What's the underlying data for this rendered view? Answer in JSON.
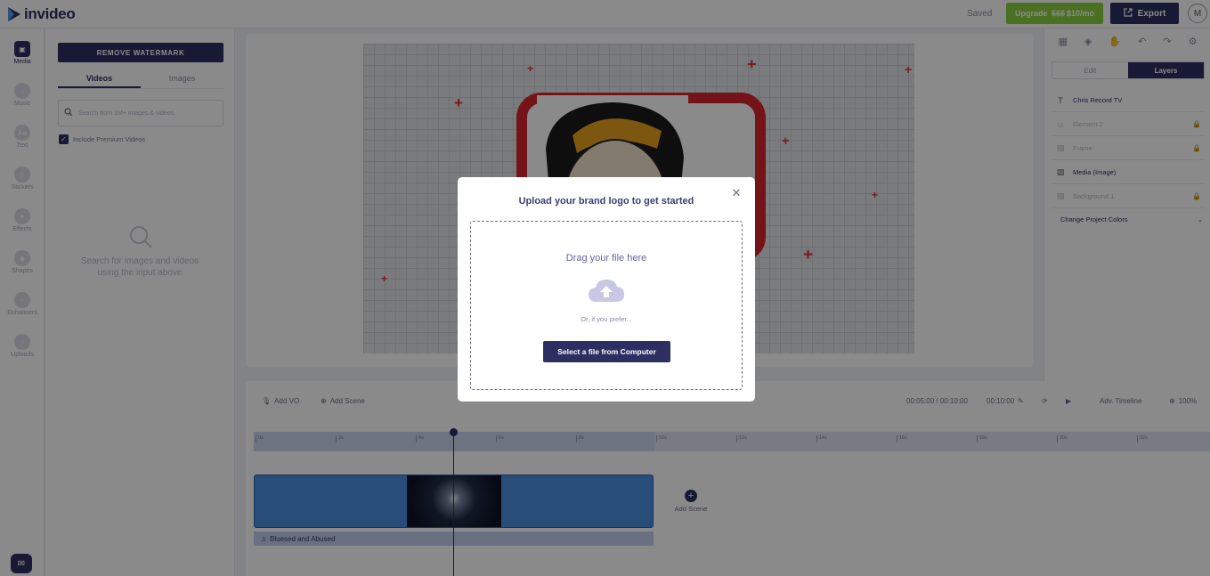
{
  "app": {
    "name": "invideo"
  },
  "header": {
    "saved_label": "Saved",
    "upgrade_label": "Upgrade",
    "upgrade_old_price": "$$$",
    "upgrade_price": "$10/mo",
    "export_label": "Export",
    "avatar_initial": "M"
  },
  "rail": {
    "items": [
      {
        "label": "Media",
        "icon": "media-icon"
      },
      {
        "label": "Music",
        "icon": "music-icon"
      },
      {
        "label": "Text",
        "icon": "text-icon"
      },
      {
        "label": "Stickers",
        "icon": "sticker-icon"
      },
      {
        "label": "Effects",
        "icon": "effects-icon"
      },
      {
        "label": "Shapes",
        "icon": "shapes-icon"
      },
      {
        "label": "Enhancers",
        "icon": "enhancers-icon"
      },
      {
        "label": "Uploads",
        "icon": "uploads-icon"
      }
    ]
  },
  "media": {
    "remove_watermark_label": "REMOVE WATERMARK",
    "tabs": [
      {
        "label": "Videos"
      },
      {
        "label": "Images"
      }
    ],
    "search_placeholder": "Search from 1M+ images & videos",
    "premium_label": "Include Premium Videos",
    "empty_text": "Search for images and videos using the input above"
  },
  "right_panel": {
    "tabs": [
      {
        "label": "Edit"
      },
      {
        "label": "Layers"
      }
    ],
    "layers": [
      {
        "name": "Chris Record TV",
        "icon": "text-layer-icon",
        "dim": false,
        "locked": false
      },
      {
        "name": "Element 2",
        "icon": "element-layer-icon",
        "dim": true,
        "locked": true
      },
      {
        "name": "Frame",
        "icon": "frame-layer-icon",
        "dim": true,
        "locked": true
      },
      {
        "name": "Media (Image)",
        "icon": "image-layer-icon",
        "dim": false,
        "locked": false
      },
      {
        "name": "Background 1",
        "icon": "background-layer-icon",
        "dim": true,
        "locked": true
      }
    ],
    "change_colors_label": "Change Project Colors"
  },
  "timeline": {
    "add_vo_label": "Add VO",
    "add_scene_label": "Add Scene",
    "time_readout": "00:05:00 / 00:10:00",
    "duration": "00:10:00",
    "adv_timeline_label": "Adv. Timeline",
    "zoom": "100%",
    "ruler_ticks": [
      "0s",
      "2s",
      "4s",
      "6s",
      "8s",
      "10s",
      "12s",
      "14s",
      "16s",
      "18s",
      "20s",
      "22s"
    ],
    "add_scene_track_label": "Add Scene",
    "audio_track_label": "Bluesed and Abused"
  },
  "modal": {
    "title": "Upload your brand logo to get started",
    "drag_text": "Drag your file here",
    "prefer_text": "Or, if you prefer...",
    "select_button_label": "Select a file from Computer"
  }
}
